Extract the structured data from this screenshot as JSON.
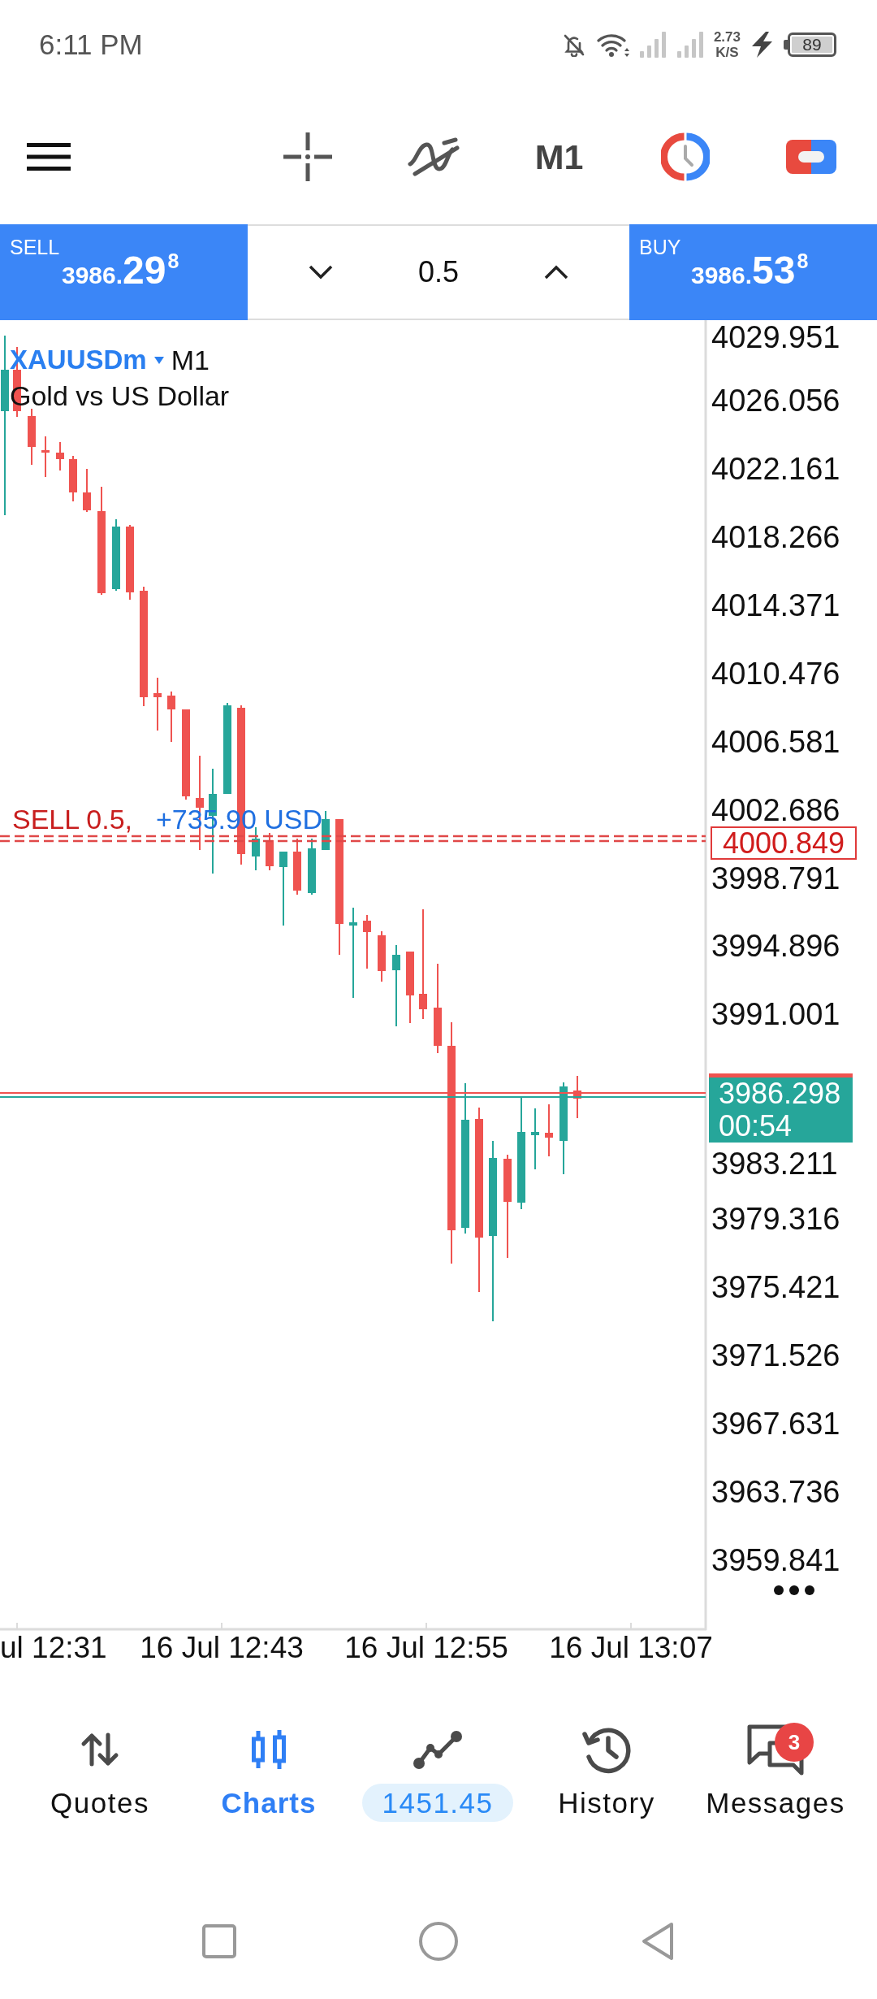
{
  "status_bar": {
    "time": "6:11 PM",
    "data_rate": "2.73",
    "data_rate_unit": "K/S",
    "battery": "89"
  },
  "toolbar": {
    "timeframe": "M1"
  },
  "trade_panel": {
    "sell": {
      "label": "SELL",
      "price_prefix": "3986.",
      "price_pips": "29",
      "price_fraction": "8"
    },
    "volume": "0.5",
    "buy": {
      "label": "BUY",
      "price_prefix": "3986.",
      "price_pips": "53",
      "price_fraction": "8"
    }
  },
  "chart": {
    "symbol": "XAUUSDm",
    "timeframe": "M1",
    "description": "Gold vs US Dollar",
    "price_axis": {
      "labels_above": [
        "4029.951",
        "4026.056",
        "4022.161",
        "4018.266",
        "4014.371",
        "4010.476",
        "4006.581",
        "4002.686",
        "3998.791",
        "3994.896",
        "3991.001"
      ],
      "labels_below": [
        "3983.211",
        "3979.316",
        "3975.421",
        "3971.526",
        "3967.631",
        "3963.736",
        "3959.841"
      ]
    },
    "order": {
      "label": "SELL 0.5,",
      "profit": "+735.90 USD",
      "price": "4000.849"
    },
    "price_tag": {
      "price": "3986.298",
      "countdown": "00:54"
    },
    "time_axis": [
      "ul 12:31",
      "16 Jul 12:43",
      "16 Jul 12:55",
      "16 Jul 13:07"
    ]
  },
  "bottom_nav": [
    {
      "kind": "tab",
      "label": "Quotes",
      "selected": false
    },
    {
      "kind": "tab",
      "label": "Charts",
      "selected": true
    },
    {
      "kind": "balance",
      "label": "1451.45",
      "selected": false
    },
    {
      "kind": "tab",
      "label": "History",
      "selected": false
    },
    {
      "kind": "tab",
      "label": "Messages",
      "selected": false,
      "badge": "3"
    }
  ]
}
